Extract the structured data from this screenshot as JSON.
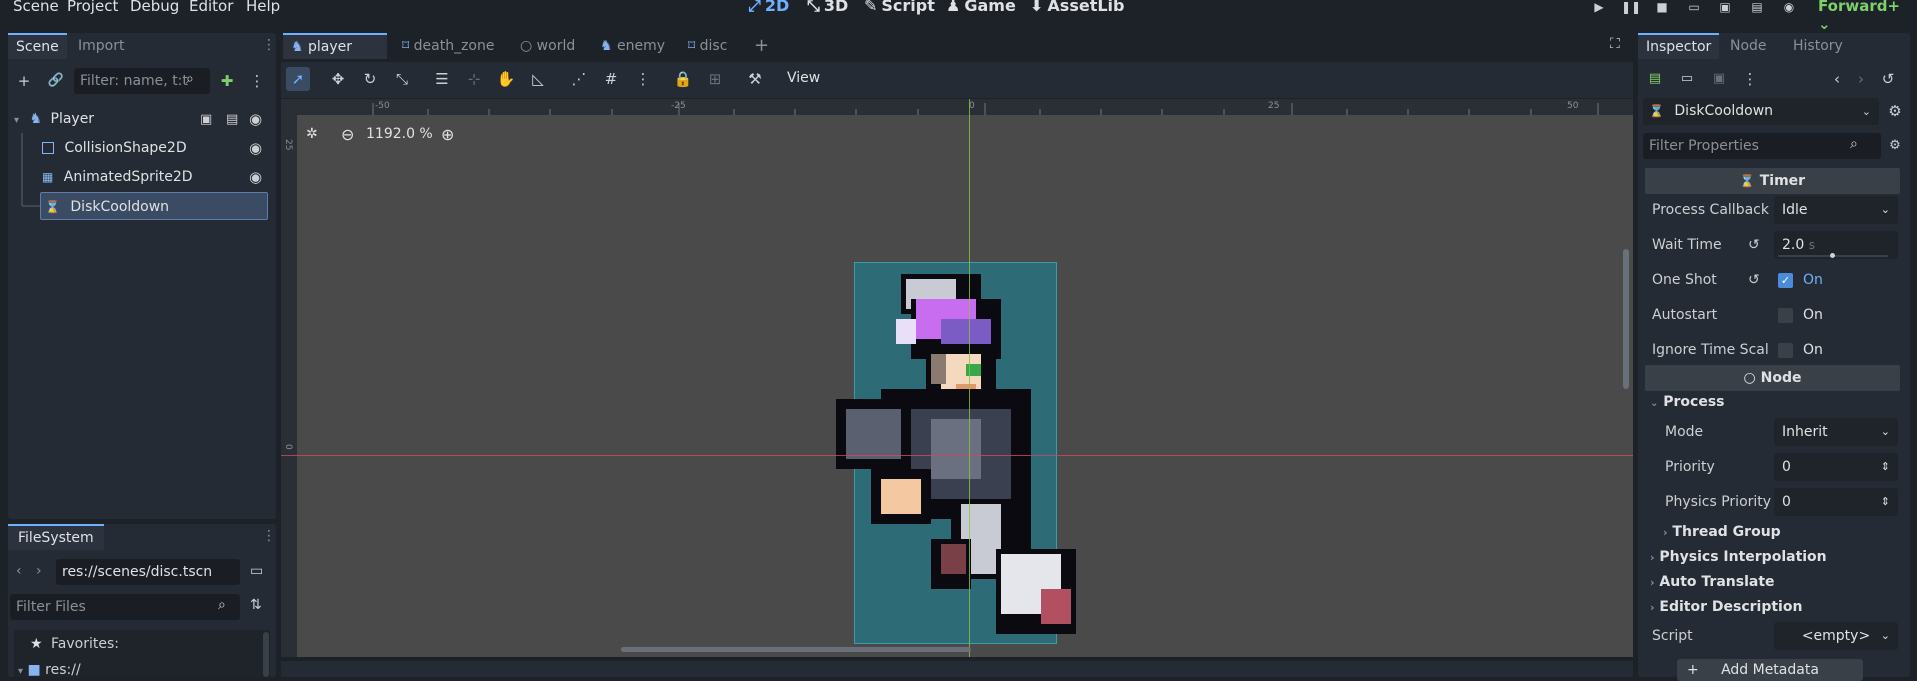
{
  "menu": {
    "items": [
      "Scene",
      "Project",
      "Debug",
      "Editor",
      "Help"
    ]
  },
  "workspaces": [
    {
      "label": "2D",
      "icon": "⤢",
      "active": true
    },
    {
      "label": "3D",
      "icon": "⤡"
    },
    {
      "label": "Script",
      "icon": "✎"
    },
    {
      "label": "Game",
      "icon": "♟"
    },
    {
      "label": "AssetLib",
      "icon": "⬇"
    }
  ],
  "renderer": "Forward+",
  "scene_panel": {
    "tabs": [
      "Scene",
      "Import"
    ],
    "filter_placeholder": "Filter: name, t:t",
    "nodes": [
      {
        "name": "Player",
        "icon": "person-icon"
      },
      {
        "name": "CollisionShape2D",
        "icon": "collision-icon"
      },
      {
        "name": "AnimatedSprite2D",
        "icon": "sprite-icon"
      },
      {
        "name": "DiskCooldown",
        "icon": "timer-icon"
      }
    ]
  },
  "filesystem": {
    "tab": "FileSystem",
    "path": "res://scenes/disc.tscn",
    "filter_placeholder": "Filter Files",
    "favorites": "Favorites:",
    "root": "res://"
  },
  "editor_tabs": [
    {
      "label": "player",
      "active": true
    },
    {
      "label": "death_zone"
    },
    {
      "label": "world"
    },
    {
      "label": "enemy"
    },
    {
      "label": "disc"
    }
  ],
  "toolbar": {
    "view_label": "View"
  },
  "viewport": {
    "zoom": "1192.0 %",
    "ruler": [
      "-50",
      "-25",
      "0",
      "25",
      "50"
    ],
    "ruler_v": [
      "25",
      "0"
    ]
  },
  "inspector": {
    "tabs": [
      "Inspector",
      "Node",
      "History"
    ],
    "node_name": "DiskCooldown",
    "filter_placeholder": "Filter Properties",
    "category_timer": "Timer",
    "props": [
      {
        "label": "Process Callback",
        "value": "Idle"
      },
      {
        "label": "Wait Time",
        "value": "2.0",
        "unit": "s"
      },
      {
        "label": "One Shot",
        "value": "On",
        "checked": true
      },
      {
        "label": "Autostart",
        "value": "On",
        "checked": false
      },
      {
        "label": "Ignore Time Scal",
        "value": "On",
        "checked": false
      }
    ],
    "category_node": "Node",
    "section_process": "Process",
    "process_props": [
      {
        "label": "Mode",
        "value": "Inherit"
      },
      {
        "label": "Priority",
        "value": "0"
      },
      {
        "label": "Physics Priority",
        "value": "0"
      }
    ],
    "thread_group": "Thread Group",
    "sections": [
      "Physics Interpolation",
      "Auto Translate",
      "Editor Description"
    ],
    "script_label": "Script",
    "script_value": "<empty>",
    "add_metadata": "Add Metadata"
  },
  "colors": {
    "accent": "#6fb0ff",
    "selection": "#3a4b63",
    "collision": "#2a7f8c",
    "play": "#6fb0ff"
  }
}
